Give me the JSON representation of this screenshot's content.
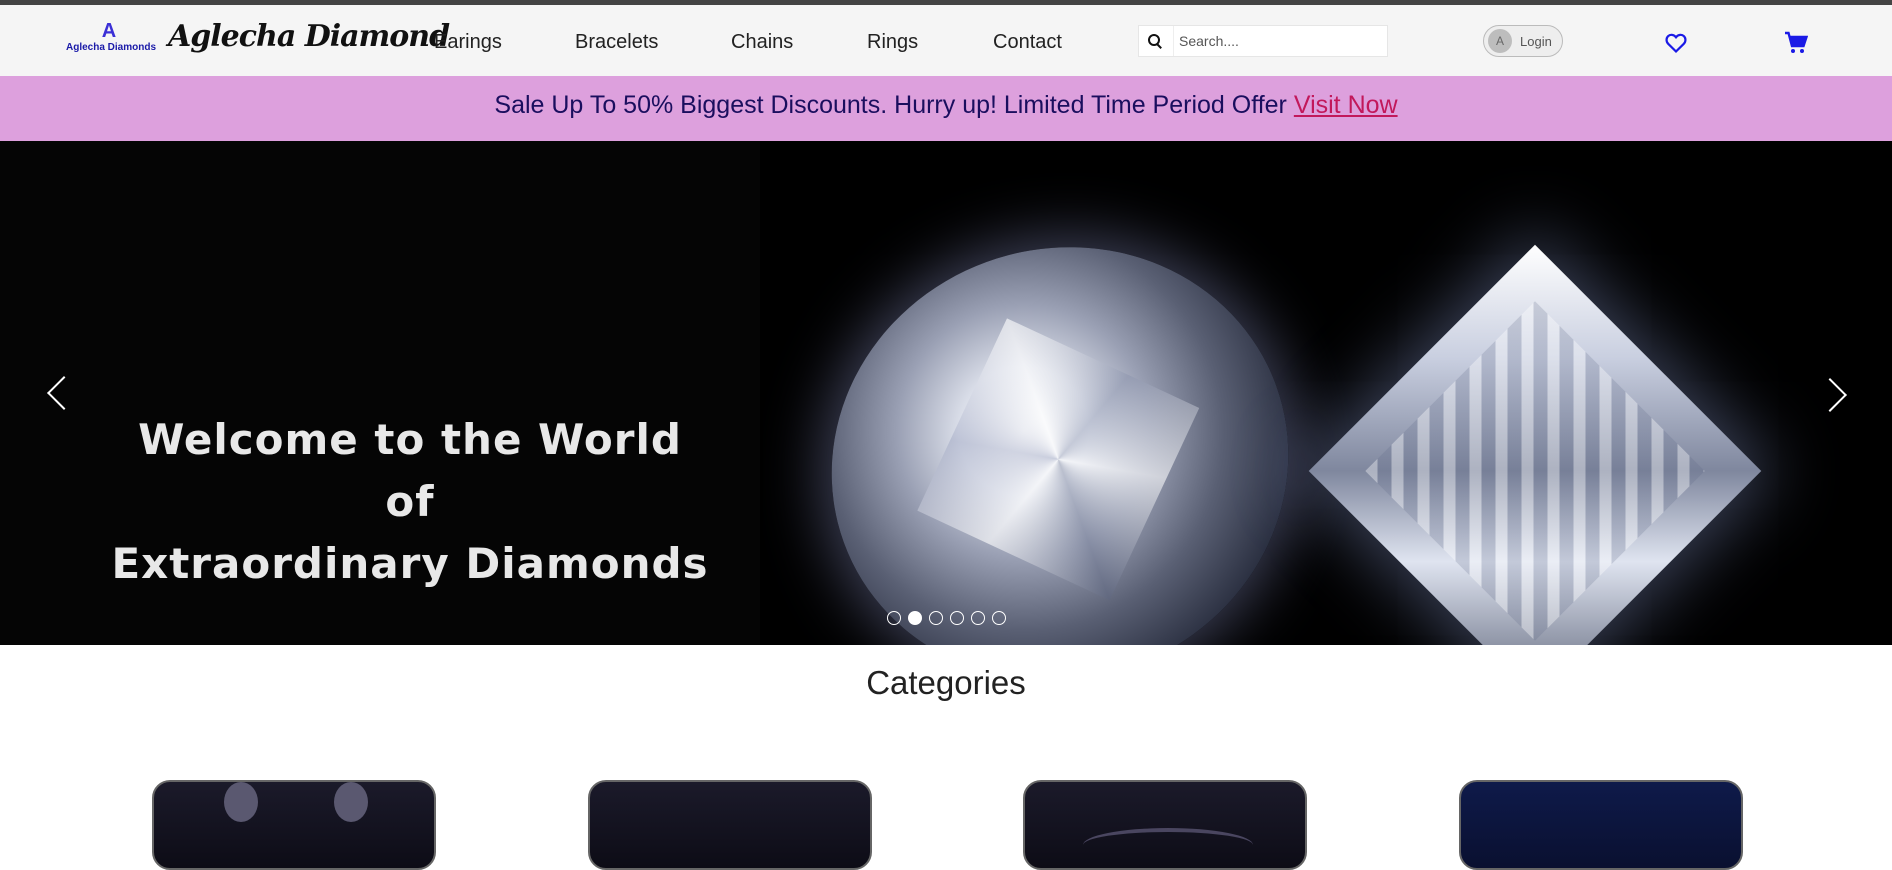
{
  "brand": {
    "logo_mark": "A",
    "logo_text": "Aglecha Diamonds",
    "script_name": "Aglecha Diamond"
  },
  "nav": {
    "items": [
      "Earings",
      "Bracelets",
      "Chains",
      "Rings",
      "Contact"
    ]
  },
  "search": {
    "placeholder": "Search....",
    "value": ""
  },
  "account": {
    "avatar_letter": "A",
    "login_label": "Login"
  },
  "icons": {
    "search": "search-icon",
    "wishlist": "heart-icon",
    "cart": "cart-icon",
    "prev": "chevron-left-icon",
    "next": "chevron-right-icon"
  },
  "promo": {
    "text": "Sale Up To 50% Biggest Discounts. Hurry up! Limited Time Period Offer ",
    "link_label": "Visit Now"
  },
  "hero": {
    "headline_line1": "Welcome to the World of",
    "headline_line2": "Extraordinary Diamonds",
    "slide_count": 6,
    "active_slide": 2
  },
  "categories": {
    "title": "Categories"
  },
  "colors": {
    "promo_bg": "#dda0dd",
    "promo_text": "#1a0e5e",
    "promo_link": "#c2185b",
    "accent_icons": "#1a1ae6"
  }
}
